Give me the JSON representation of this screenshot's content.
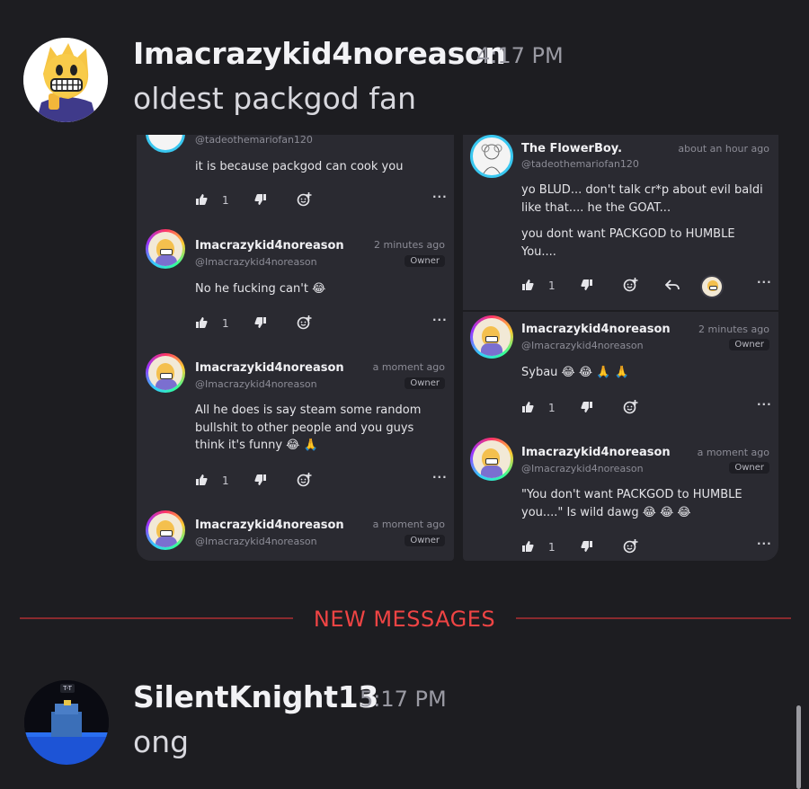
{
  "messages": [
    {
      "username": "Imacrazykid4noreason",
      "time": "4:17 PM",
      "text": "oldest packgod fan",
      "avatar_icon": "avatar-yellow-character"
    },
    {
      "username": "SilentKnight13",
      "time": "5:17 PM",
      "text": "ong",
      "avatar_icon": "avatar-blue-cube",
      "avatar_badge": "T-T"
    }
  ],
  "divider": {
    "label": "NEW MESSAGES",
    "color": "#ef4444"
  },
  "screenshot_left": {
    "top_comment": {
      "handle": "@tadeothemariofan120",
      "text": "it is because packgod can cook you",
      "likes": "1"
    },
    "comments": [
      {
        "name": "Imacrazykid4noreason",
        "handle": "@Imacrazykid4noreason",
        "time": "2 minutes ago",
        "badge": "Owner",
        "text": "No he fucking can't 😂",
        "likes": "1"
      },
      {
        "name": "Imacrazykid4noreason",
        "handle": "@Imacrazykid4noreason",
        "time": "a moment ago",
        "badge": "Owner",
        "text": "All he does is say steam some random bullshit to other people and you guys think it's funny 😂 🙏",
        "likes": "1"
      },
      {
        "name": "Imacrazykid4noreason",
        "handle": "@Imacrazykid4noreason",
        "time": "a moment ago",
        "badge": "Owner"
      }
    ]
  },
  "screenshot_right": {
    "top_comment": {
      "name": "The FlowerBoy.",
      "handle": "@tadeothemariofan120",
      "time": "about an hour ago",
      "text1": "yo BLUD... don't talk cr*p about evil baldi like that.... he the GOAT...",
      "text2": "you dont want PACKGOD to HUMBLE You....",
      "likes": "1"
    },
    "comments": [
      {
        "name": "Imacrazykid4noreason",
        "handle": "@Imacrazykid4noreason",
        "time": "2 minutes ago",
        "badge": "Owner",
        "text": "Sybau 😂 😂 🙏 🙏",
        "likes": "1"
      },
      {
        "name": "Imacrazykid4noreason",
        "handle": "@Imacrazykid4noreason",
        "time": "a moment ago",
        "badge": "Owner",
        "text": "\"You don't want PACKGOD to HUMBLE you....\" Is wild dawg 😂 😂 😂",
        "likes": "1"
      }
    ]
  }
}
